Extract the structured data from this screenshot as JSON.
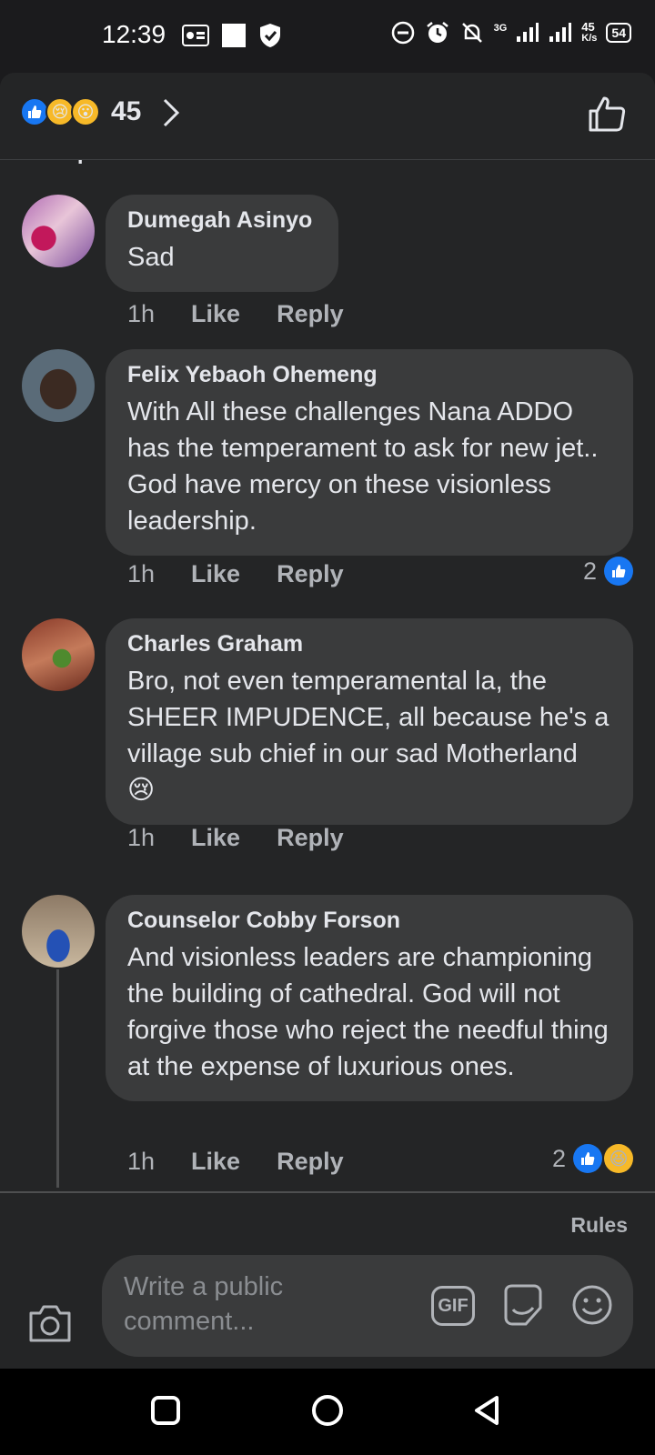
{
  "status": {
    "time": "12:39",
    "network": "3G",
    "speed_value": "45",
    "speed_unit": "K/s",
    "battery": "54"
  },
  "header": {
    "reaction_count": "45",
    "reaction_icons": [
      "like-icon",
      "sad-icon",
      "wow-icon"
    ]
  },
  "view_previous": "View previous comments...",
  "comments": [
    {
      "author": "Dumegah Asinyo",
      "text": "Sad",
      "time": "1h",
      "like": "Like",
      "reply": "Reply",
      "reactions": ""
    },
    {
      "author": "Felix Yebaoh Ohemeng",
      "text": "With All these challenges Nana ADDO has the temperament to ask for new jet.. God have mercy on these visionless leadership.",
      "time": "1h",
      "like": "Like",
      "reply": "Reply",
      "reactions": "2"
    },
    {
      "author": "Charles Graham",
      "text": "Bro, not even temperamental la, the SHEER  IMPUDENCE, all because he's a village sub chief in  our sad Motherland 😢",
      "time": "1h",
      "like": "Like",
      "reply": "Reply",
      "reactions": ""
    },
    {
      "author": "Counselor Cobby Forson",
      "text": "And visionless leaders are championing the building of cathedral. God will not forgive those who reject the needful thing at the expense of luxurious ones.",
      "time": "1h",
      "like": "Like",
      "reply": "Reply",
      "reactions": "2"
    }
  ],
  "footer": {
    "rules": "Rules",
    "placeholder": "Write a public comment...",
    "gif": "GIF"
  },
  "colors": {
    "background": "#242526",
    "bubble": "#3a3b3c",
    "like_blue": "#1877f2",
    "secondary_text": "#b0b3b8"
  }
}
